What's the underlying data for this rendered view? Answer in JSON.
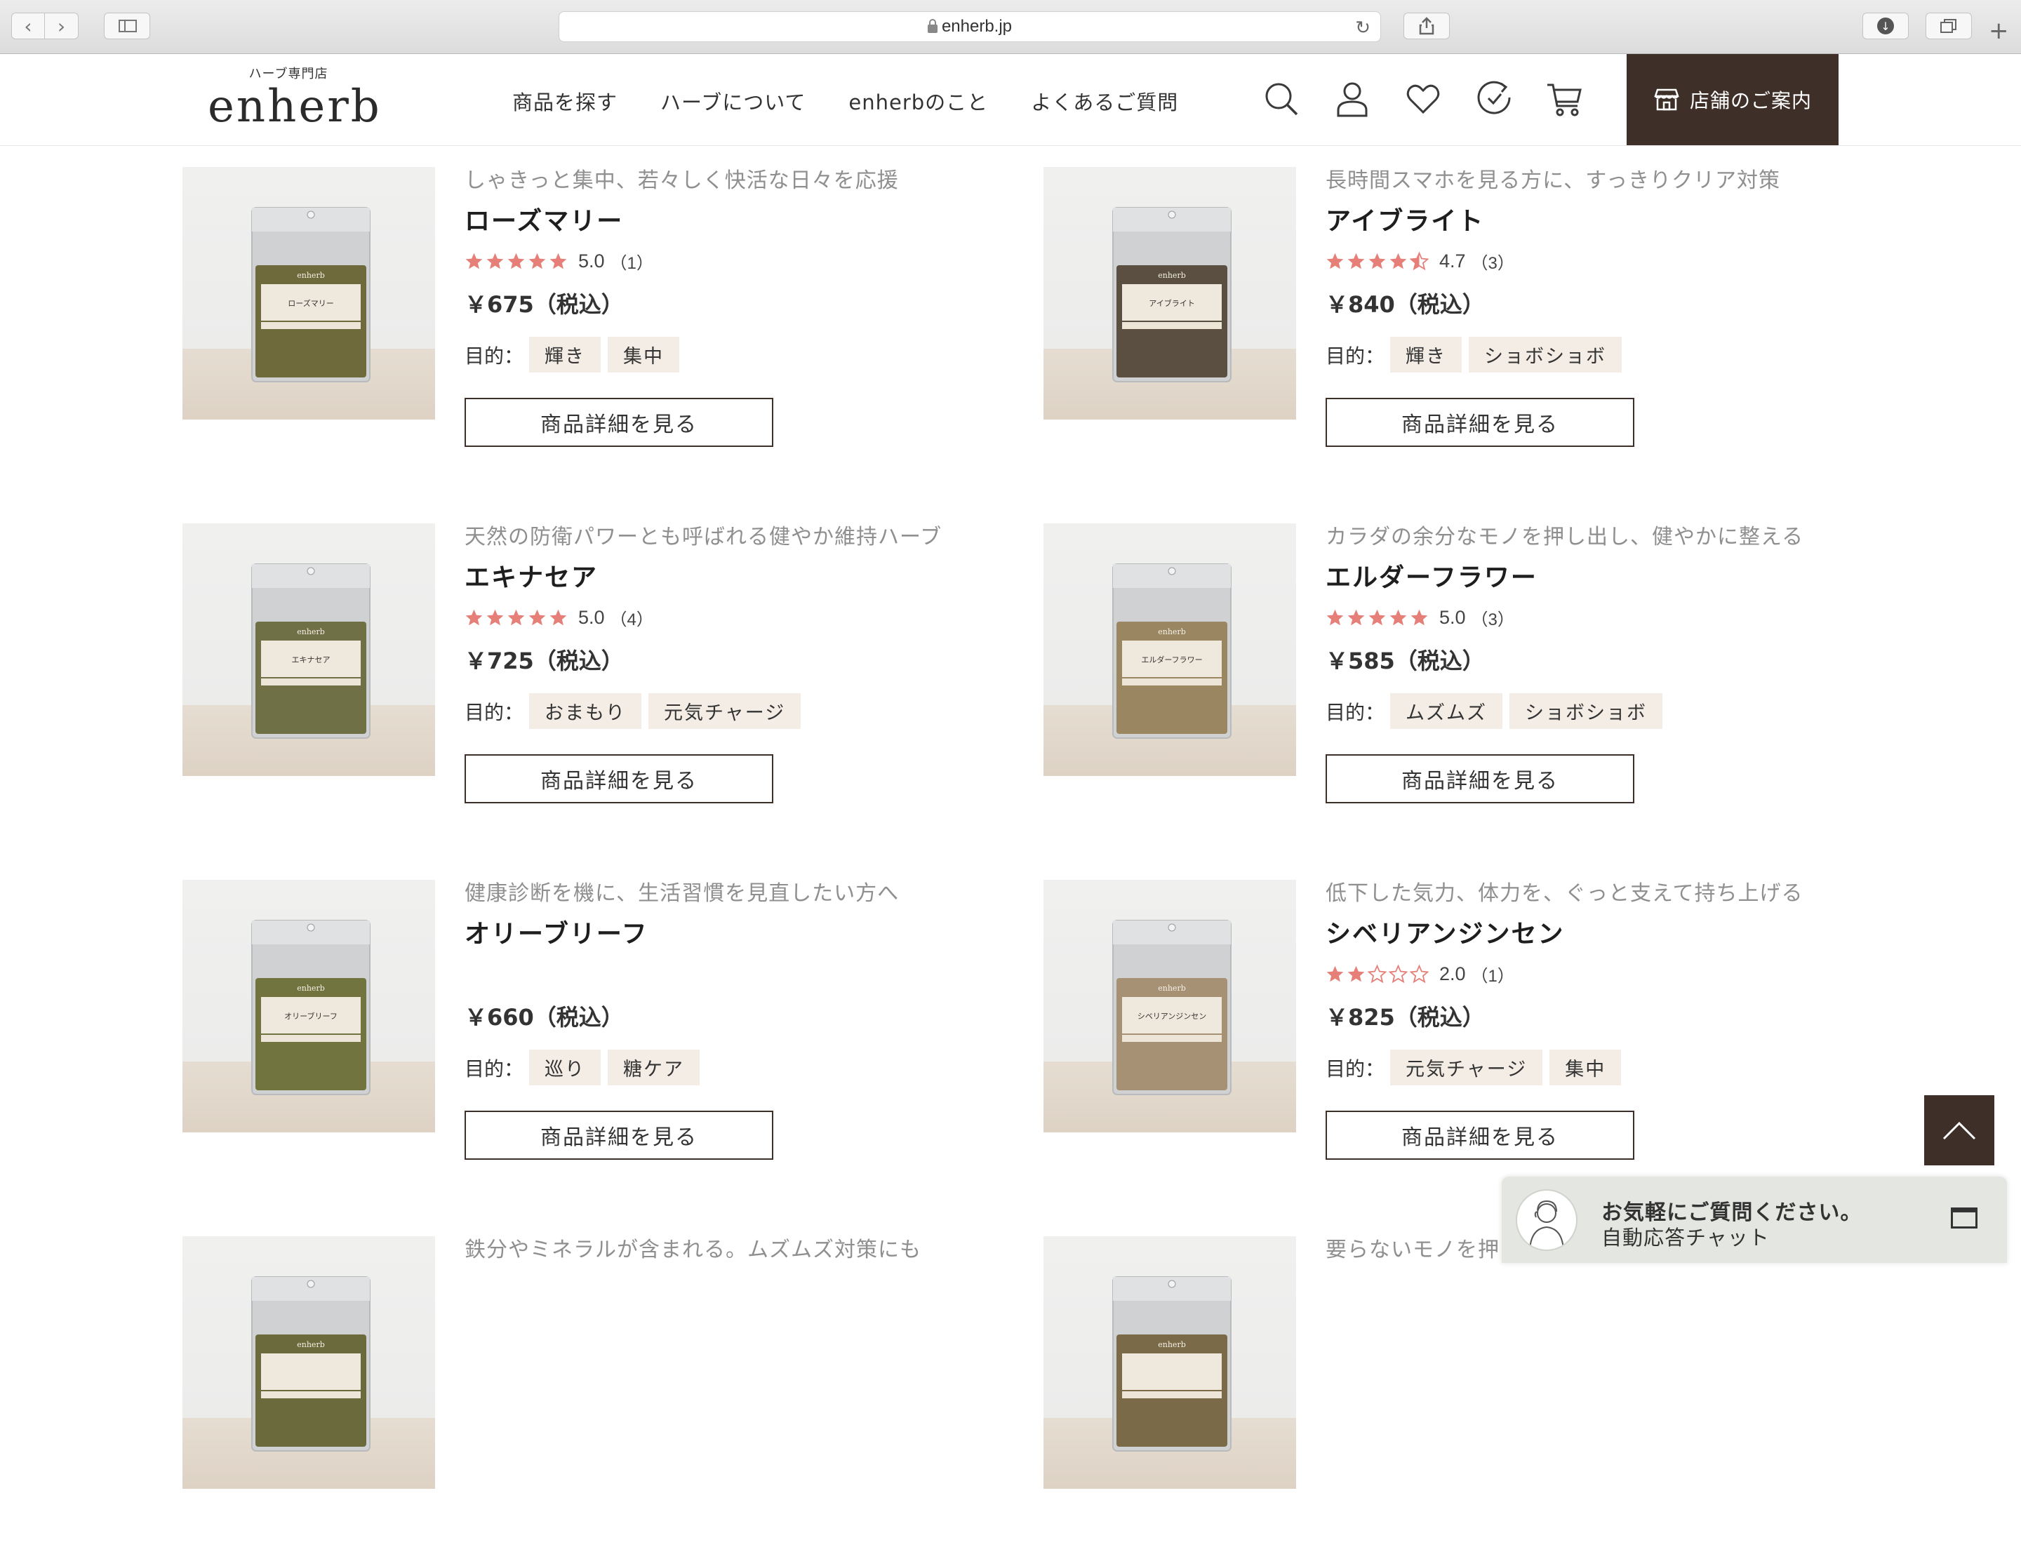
{
  "browser": {
    "url": "enherb.jp"
  },
  "header": {
    "logo_sub": "ハーブ専門店",
    "logo_main": "enherb",
    "nav": [
      {
        "label": "商品を探す"
      },
      {
        "label": "ハーブについて"
      },
      {
        "label": "enherbのこと"
      },
      {
        "label": "よくあるご質問"
      }
    ],
    "icons": [
      "search-icon",
      "account-icon",
      "favorite-heart-icon",
      "history-clock-icon",
      "cart-icon"
    ],
    "store_label": "店舗のご案内"
  },
  "products": [
    {
      "catch": "しゃきっと集中、若々しく快活な日々を応援",
      "name": "ローズマリー",
      "rating": 5.0,
      "rating_text": "5.0",
      "count_text": "（1）",
      "price": "￥675（税込）",
      "purpose_label": "目的：",
      "tags": [
        "輝き",
        "集中"
      ],
      "button": "商品詳細を見る",
      "package_label": "ローズマリー",
      "herb_color": "#6f6a3c"
    },
    {
      "catch": "長時間スマホを見る方に、すっきりクリア対策",
      "name": "アイブライト",
      "rating": 4.5,
      "rating_text": "4.7",
      "count_text": "（3）",
      "price": "￥840（税込）",
      "purpose_label": "目的：",
      "tags": [
        "輝き",
        "ショボショボ"
      ],
      "button": "商品詳細を見る",
      "package_label": "アイブライト",
      "herb_color": "#5a4f40"
    },
    {
      "catch": "天然の防衛パワーとも呼ばれる健やか維持ハーブ",
      "name": "エキナセア",
      "rating": 5.0,
      "rating_text": "5.0",
      "count_text": "（4）",
      "price": "￥725（税込）",
      "purpose_label": "目的：",
      "tags": [
        "おまもり",
        "元気チャージ"
      ],
      "button": "商品詳細を見る",
      "package_label": "エキナセア",
      "herb_color": "#707047"
    },
    {
      "catch": "カラダの余分なモノを押し出し、健やかに整える",
      "name": "エルダーフラワー",
      "rating": 5.0,
      "rating_text": "5.0",
      "count_text": "（3）",
      "price": "￥585（税込）",
      "purpose_label": "目的：",
      "tags": [
        "ムズムズ",
        "ショボショボ"
      ],
      "button": "商品詳細を見る",
      "package_label": "エルダーフラワー",
      "herb_color": "#9a8660"
    },
    {
      "catch": "健康診断を機に、生活習慣を見直したい方へ",
      "name": "オリーブリーフ",
      "rating": null,
      "rating_text": "",
      "count_text": "",
      "price": "￥660（税込）",
      "purpose_label": "目的：",
      "tags": [
        "巡り",
        "糖ケア"
      ],
      "button": "商品詳細を見る",
      "package_label": "オリーブリーフ",
      "herb_color": "#72743f"
    },
    {
      "catch": "低下した気力、体力を、ぐっと支えて持ち上げる",
      "name": "シベリアンジンセン",
      "rating": 2.0,
      "rating_text": "2.0",
      "count_text": "（1）",
      "price": "￥825（税込）",
      "purpose_label": "目的：",
      "tags": [
        "元気チャージ",
        "集中"
      ],
      "button": "商品詳細を見る",
      "package_label": "シベリアンジンセン",
      "herb_color": "#a69174"
    },
    {
      "catch": "鉄分やミネラルが含まれる。ムズムズ対策にも",
      "name": "",
      "rating": null,
      "rating_text": "",
      "count_text": "",
      "price": "",
      "purpose_label": "",
      "tags": [],
      "button": "",
      "package_label": "",
      "herb_color": "#6a6a3c"
    },
    {
      "catch": "要らないモノを押",
      "name": "",
      "rating": null,
      "rating_text": "",
      "count_text": "",
      "price": "",
      "purpose_label": "",
      "tags": [],
      "button": "",
      "package_label": "",
      "herb_color": "#7a6a48"
    }
  ],
  "chat": {
    "title": "お気軽にご質問ください。",
    "subtitle": "自動応答チャット"
  },
  "colors": {
    "brand_dark": "#3e3029",
    "star": "#e57f78",
    "tag_bg": "#f3ede6"
  }
}
